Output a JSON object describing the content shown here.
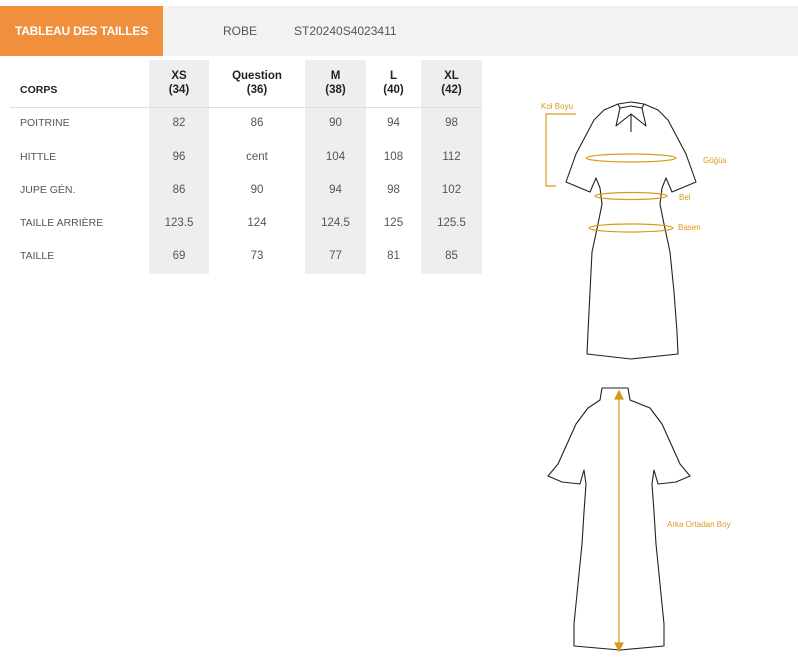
{
  "header": {
    "tab_label": "TABLEAU DES TAILLES",
    "category": "ROBE",
    "product_code": "ST20240S4023411"
  },
  "table": {
    "corner_label": "CORPS",
    "columns": [
      {
        "size": "XS",
        "num": "(34)"
      },
      {
        "size": "Question",
        "num": "(36)"
      },
      {
        "size": "M",
        "num": "(38)"
      },
      {
        "size": "L",
        "num": "(40)"
      },
      {
        "size": "XL",
        "num": "(42)"
      }
    ],
    "rows": [
      {
        "label": "POITRINE",
        "values": [
          "82",
          "86",
          "90",
          "94",
          "98"
        ]
      },
      {
        "label": "HITTLE",
        "values": [
          "96",
          "cent",
          "104",
          "108",
          "112"
        ]
      },
      {
        "label": "JUPE GÉN.",
        "values": [
          "86",
          "90",
          "94",
          "98",
          "102"
        ]
      },
      {
        "label": "TAILLE ARRIÈRE",
        "values": [
          "123.5",
          "124",
          "124.5",
          "125",
          "125.5"
        ]
      },
      {
        "label": "TAILLE",
        "values": [
          "69",
          "73",
          "77",
          "81",
          "85"
        ]
      }
    ]
  },
  "diagram": {
    "front_labels": {
      "sleeve": "Kol Boyu",
      "chest": "Göğüs",
      "waist": "Bel",
      "hip": "Basen"
    },
    "back_labels": {
      "length": "Arka Ortadan Boy"
    },
    "accent_color": "#d99a1c",
    "tab_color": "#f0903c"
  }
}
